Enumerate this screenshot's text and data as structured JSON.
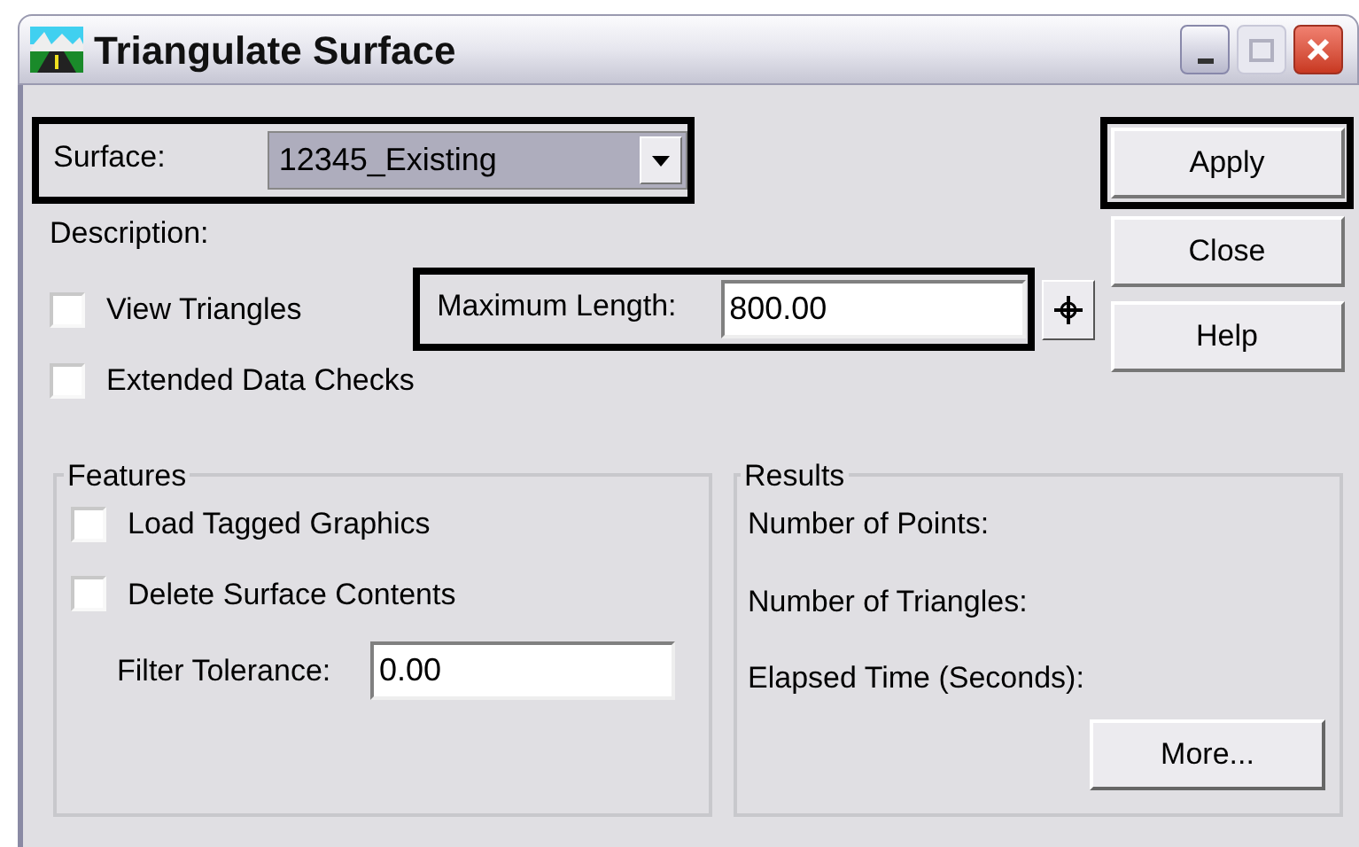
{
  "window": {
    "title": "Triangulate Surface"
  },
  "surface": {
    "label": "Surface:",
    "value": "12345_Existing",
    "highlighted": true
  },
  "description": {
    "label": "Description:"
  },
  "options": [
    {
      "label": "View Triangles",
      "checked": false
    },
    {
      "label": "Extended Data Checks",
      "checked": false
    }
  ],
  "maximum_length": {
    "label": "Maximum Length:",
    "value": "800.00",
    "highlighted": true
  },
  "buttons": [
    {
      "label": "Apply",
      "highlighted": true
    },
    {
      "label": "Close",
      "highlighted": false
    },
    {
      "label": "Help",
      "highlighted": false
    }
  ],
  "features": {
    "title": "Features",
    "options": [
      {
        "label": "Load Tagged Graphics",
        "checked": false
      },
      {
        "label": "Delete Surface Contents",
        "checked": false
      }
    ],
    "filter_tolerance": {
      "label": "Filter Tolerance:",
      "value": "0.00"
    }
  },
  "results": {
    "title": "Results",
    "rows": [
      "Number of Points:",
      "Number of Triangles:",
      "Elapsed Time (Seconds):"
    ],
    "button": "More..."
  }
}
